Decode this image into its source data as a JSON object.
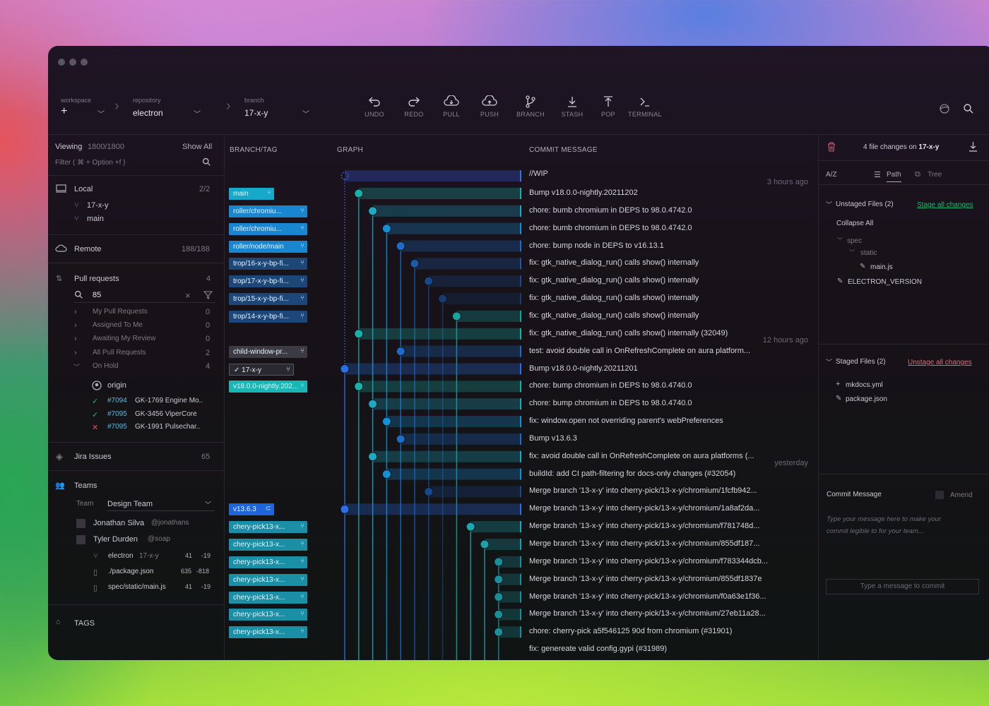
{
  "toolbar": {
    "workspace_label": "workspace",
    "repository_label": "repository",
    "repository_value": "electron",
    "branch_label": "branch",
    "branch_value": "17-x-y",
    "tools": [
      "UNDO",
      "REDO",
      "PULL",
      "PUSH",
      "BRANCH",
      "STASH",
      "POP",
      "TERMINAL"
    ]
  },
  "left": {
    "viewing_label": "Viewing",
    "viewing_count": "1800/1800",
    "show_all": "Show All",
    "filter_placeholder": "Filter ( ⌘ + Option +f )",
    "local_label": "Local",
    "local_count": "2/2",
    "local_branches": [
      "17-x-y",
      "main"
    ],
    "remote_label": "Remote",
    "remote_count": "188/188",
    "pr_label": "Pull requests",
    "pr_count": "4",
    "pr_search": "85",
    "pr_groups": [
      {
        "label": "My Pull Requests",
        "count": "0"
      },
      {
        "label": "Assigned To Me",
        "count": "0"
      },
      {
        "label": "Awaiting My Review",
        "count": "0"
      },
      {
        "label": "All Pull Requests",
        "count": "2"
      },
      {
        "label": "On Hold",
        "count": "4"
      }
    ],
    "origin_label": "origin",
    "prs": [
      {
        "num": "#7094",
        "title": "GK-1769 Engine Mo..",
        "status": "ok"
      },
      {
        "num": "#7095",
        "title": "GK-3456 ViperCore",
        "status": "ok"
      },
      {
        "num": "#7095",
        "title": "GK-1991 Pulsechar..",
        "status": "fail"
      }
    ],
    "jira_label": "Jira Issues",
    "jira_count": "65",
    "teams_label": "Teams",
    "team_label": "Team",
    "team_value": "Design Team",
    "members": [
      {
        "name": "Jonathan Silva",
        "handle": "@jonathans"
      },
      {
        "name": "Tyler Durden",
        "handle": "@soap"
      }
    ],
    "files": [
      {
        "name": "electron",
        "sub": "17-x-y",
        "add": "41",
        "del": "-19"
      },
      {
        "name": "./package.json",
        "sub": "",
        "add": "635",
        "del": "-818"
      },
      {
        "name": "spec/static/main.js",
        "sub": "",
        "add": "41",
        "del": "-19"
      }
    ],
    "tags_label": "TAGS"
  },
  "graph": {
    "headers": {
      "branch": "BRANCH/TAG",
      "graph": "GRAPH",
      "message": "COMMIT MESSAGE"
    },
    "wip": "//WIP",
    "times": [
      {
        "row": 0,
        "text": "3 hours ago"
      },
      {
        "row": 9,
        "text": "12 hours ago"
      },
      {
        "row": 16,
        "text": "yesterday"
      }
    ],
    "colors": {
      "cyan": "#18b3c6",
      "blue": "#1b8fe0",
      "darkblue": "#2b59d9",
      "teal": "#1aa8a8"
    },
    "commits": [
      {
        "msg": "Bump v18.0.0-nightly.20211202",
        "branch": "main",
        "btype": "cyan",
        "lane": 1
      },
      {
        "msg": "chore: bumb chromium in DEPS to 98.0.4742.0",
        "branch": "roller/chromiu...",
        "btype": "blue",
        "lane": 2
      },
      {
        "msg": "chore: bumb chromium in DEPS to 98.0.4742.0",
        "branch": "roller/chromiu...",
        "btype": "blue",
        "lane": 3
      },
      {
        "msg": "chore: bump node in DEPS to v16.13.1",
        "branch": "roller/node/main",
        "btype": "blue",
        "lane": 4
      },
      {
        "msg": "fix: gtk_native_dialog_run() calls show() internally",
        "branch": "trop/16-x-y-bp-fi...",
        "btype": "navy",
        "lane": 5
      },
      {
        "msg": "fix: gtk_native_dialog_run() calls show() internally",
        "branch": "trop/17-x-y-bp-fi...",
        "btype": "navy",
        "lane": 6
      },
      {
        "msg": "fix: gtk_native_dialog_run() calls show() internally",
        "branch": "trop/15-x-y-bp-fi...",
        "btype": "navy",
        "lane": 7
      },
      {
        "msg": "fix: gtk_native_dialog_run() calls show() internally",
        "branch": "trop/14-x-y-bp-fi...",
        "btype": "navy",
        "lane": 8
      },
      {
        "msg": "fix: gtk_native_dialog_run() calls show() internally (32049)",
        "branch": "",
        "btype": "",
        "lane": 1
      },
      {
        "msg": "test: avoid double call in OnRefreshComplete on aura platform...",
        "branch": "child-window-pr...",
        "btype": "gray",
        "lane": 4
      },
      {
        "msg": "Bump v18.0.0-nightly.20211201",
        "branch": "17-x-y",
        "btype": "check",
        "lane": 0
      },
      {
        "msg": "chore: bump chromium in DEPS to 98.0.4740.0",
        "branch": "v18.0.0-nightly.202...",
        "btype": "tealtag",
        "lane": 1
      },
      {
        "msg": "chore: bump chromium in DEPS to 98.0.4740.0",
        "branch": "",
        "btype": "",
        "lane": 2
      },
      {
        "msg": "fix: window.open not overriding parent's webPreferences",
        "branch": "",
        "btype": "",
        "lane": 3
      },
      {
        "msg": "Bump v13.6.3",
        "branch": "",
        "btype": "",
        "lane": 4
      },
      {
        "msg": "fix: avoid double call in OnRefreshComplete on aura platforms (...",
        "branch": "",
        "btype": "",
        "lane": 2
      },
      {
        "msg": "buildId: add CI path-filtering for docs-only changes (#32054)",
        "branch": "",
        "btype": "",
        "lane": 3
      },
      {
        "msg": "Merge branch '13-x-y' into cherry-pick/13-x-y/chromium/1fcfb942...",
        "branch": "",
        "btype": "",
        "lane": 6
      },
      {
        "msg": "Merge branch '13-x-y' into cherry-pick/13-x-y/chromium/1a8af2da...",
        "branch": "v13.6.3",
        "btype": "bluetag",
        "lane": 0
      },
      {
        "msg": "Merge branch '13-x-y' into cherry-pick/13-x-y/chromium/f781748d...",
        "branch": "chery-pick13-x...",
        "btype": "teal",
        "lane": 9
      },
      {
        "msg": "Merge branch '13-x-y' into cherry-pick/13-x-y/chromium/855df187...",
        "branch": "chery-pick13-x...",
        "btype": "teal",
        "lane": 10
      },
      {
        "msg": "Merge branch '13-x-y' into cherry-pick/13-x-y/chromium/f783344dcb...",
        "branch": "chery-pick13-x...",
        "btype": "teal",
        "lane": 11
      },
      {
        "msg": "Merge branch '13-x-y' into cherry-pick/13-x-y/chromium/855df1837e",
        "branch": "chery-pick13-x...",
        "btype": "teal",
        "lane": 11
      },
      {
        "msg": "Merge branch '13-x-y' into cherry-pick/13-x-y/chromium/f0a63e1f36...",
        "branch": "chery-pick13-x...",
        "btype": "teal",
        "lane": 11
      },
      {
        "msg": "Merge branch '13-x-y' into cherry-pick/13-x-y/chromium/27eb11a28...",
        "branch": "chery-pick13-x...",
        "btype": "teal",
        "lane": 11
      },
      {
        "msg": "chore: cherry-pick a5f546125 90d from chromium (#31901)",
        "branch": "chery-pick13-x...",
        "btype": "teal",
        "lane": 11
      },
      {
        "msg": "fix: genereate valid config.gypi (#31989)",
        "branch": "",
        "btype": "",
        "lane": -1
      }
    ]
  },
  "right": {
    "changes_prefix": "4 file changes on",
    "changes_branch": "17-x-y",
    "sort_label": "A/Z",
    "path_label": "Path",
    "tree_label": "Tree",
    "unstaged_label": "Unstaged Files (2)",
    "stage_all": "Stage all changes",
    "collapse_all": "Collapse All",
    "tree": [
      "spec",
      "static",
      "main.js",
      "ELECTRON_VERSION"
    ],
    "staged_label": "Staged Files (2)",
    "unstage_all": "Unstage all changes",
    "staged_files": [
      "mkdocs.yml",
      "package.json"
    ],
    "commit_label": "Commit Message",
    "amend_label": "Amend",
    "commit_placeholder": "Type your message here to make your commit legible to for your team...",
    "commit_button": "Type a message to commit"
  }
}
